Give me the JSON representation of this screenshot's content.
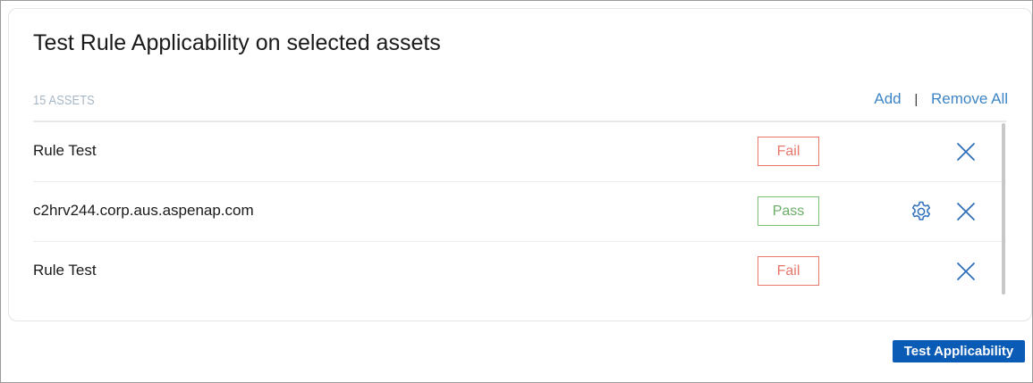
{
  "panel": {
    "title": "Test Rule Applicability on selected assets",
    "asset_count_label": "15 ASSETS",
    "add_label": "Add",
    "separator": "|",
    "remove_all_label": "Remove All"
  },
  "assets": [
    {
      "name": "Rule Test",
      "status": "Fail",
      "status_color": "#e8776b",
      "icons": [
        "close-icon"
      ]
    },
    {
      "name": "c2hrv244.corp.aus.aspenap.com",
      "status": "Pass",
      "status_color": "#6aae68",
      "icons": [
        "gear-icon",
        "close-icon"
      ]
    },
    {
      "name": "Rule Test",
      "status": "Fail",
      "status_color": "#e8776b",
      "icons": [
        "close-icon"
      ]
    }
  ],
  "footer": {
    "test_button_label": "Test Applicability"
  },
  "colors": {
    "accent": "#0a5bb5",
    "link": "#3d85c6",
    "fail": "#e8776b",
    "pass": "#6aae68"
  }
}
